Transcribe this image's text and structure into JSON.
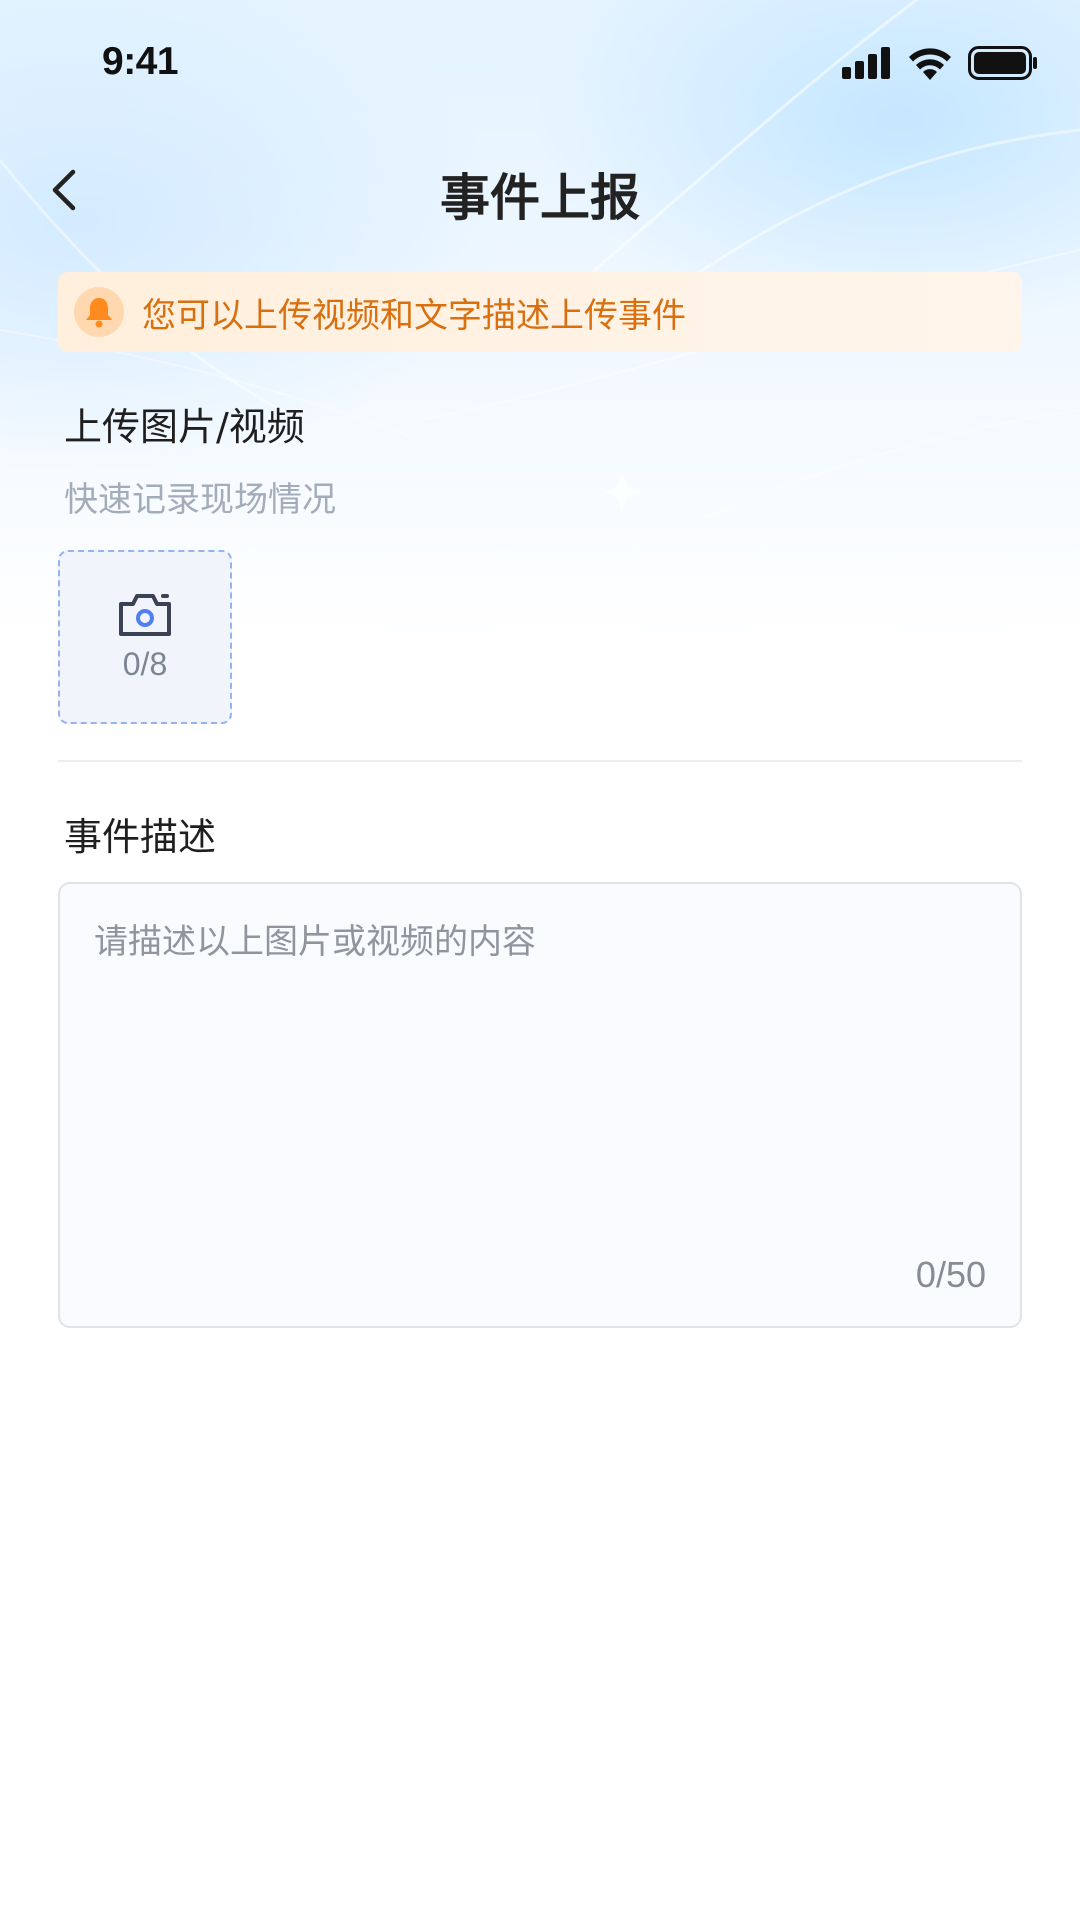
{
  "status_bar": {
    "time": "9:41",
    "icons": [
      "signal-icon",
      "wifi-icon",
      "battery-icon"
    ]
  },
  "nav": {
    "back_icon": "chevron-left-icon",
    "title": "事件上报"
  },
  "notice": {
    "icon": "bell-icon",
    "text": "您可以上传视频和文字描述上传事件"
  },
  "upload": {
    "title": "上传图片/视频",
    "subtitle": "快速记录现场情况",
    "icon": "camera-icon",
    "count": "0/8"
  },
  "description": {
    "title": "事件描述",
    "placeholder": "请描述以上图片或视频的内容",
    "count": "0/50"
  },
  "colors": {
    "notice_text": "#d8700f",
    "notice_icon": "#ff8a1e",
    "upload_border": "#93b4ef",
    "camera_accent": "#4f7ff0"
  }
}
